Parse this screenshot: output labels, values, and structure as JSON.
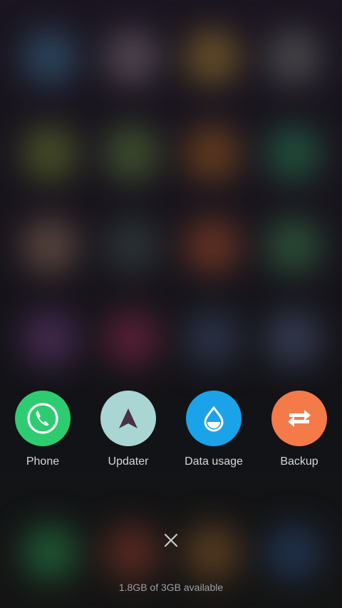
{
  "recents": {
    "apps": [
      {
        "label": "Phone",
        "icon": "phone-icon",
        "color": "#2ecc71"
      },
      {
        "label": "Updater",
        "icon": "arrow-up-icon",
        "color": "#a9d6d2"
      },
      {
        "label": "Data usage",
        "icon": "water-drop-icon",
        "color": "#1aa3e8"
      },
      {
        "label": "Backup",
        "icon": "swap-arrows-icon",
        "color": "#f47a4a"
      }
    ],
    "close_icon": "close-icon"
  },
  "memory": {
    "status": "1.8GB of 3GB available"
  }
}
